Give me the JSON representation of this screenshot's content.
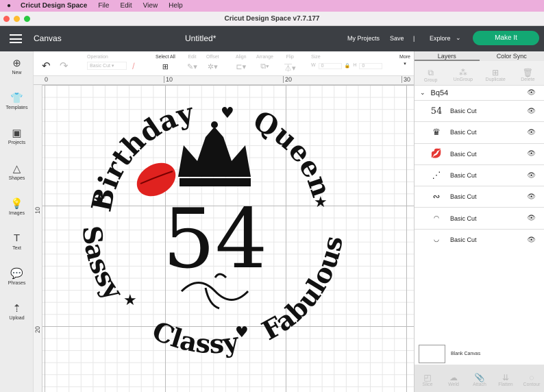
{
  "menubar": {
    "app": "Cricut Design Space",
    "items": [
      "File",
      "Edit",
      "View",
      "Help"
    ]
  },
  "window_title": "Cricut Design Space  v7.7.177",
  "header": {
    "section": "Canvas",
    "doc_title": "Untitled*",
    "my_projects": "My Projects",
    "save": "Save",
    "separator": "|",
    "explore": "Explore",
    "make_it": "Make It"
  },
  "toolbar": {
    "operation_label": "Operation",
    "operation_value": "Basic Cut",
    "select_all": "Select All",
    "edit": "Edit",
    "offset": "Offset",
    "align": "Align",
    "arrange": "Arrange",
    "flip": "Flip",
    "size": "Size",
    "w": "W",
    "h": "H",
    "w_value": "0",
    "h_value": "0",
    "more": "More"
  },
  "sidebar": [
    {
      "label": "New",
      "icon": "⊕"
    },
    {
      "label": "Templates",
      "icon": "👕"
    },
    {
      "label": "Projects",
      "icon": "▣"
    },
    {
      "label": "Shapes",
      "icon": "△"
    },
    {
      "label": "Images",
      "icon": "💡"
    },
    {
      "label": "Text",
      "icon": "T"
    },
    {
      "label": "Phrases",
      "icon": "💬"
    },
    {
      "label": "Upload",
      "icon": "⇡"
    }
  ],
  "ruler": {
    "top": [
      "0",
      "10",
      "20",
      "30"
    ],
    "left": [
      "10",
      "20"
    ]
  },
  "design": {
    "birthday": "Birthday",
    "queen": "Queen",
    "fabulous": "Fabulous",
    "classy": "Classy",
    "sassy": "Sassy",
    "number": "54"
  },
  "panel": {
    "tabs": [
      "Layers",
      "Color Sync"
    ],
    "tools": [
      "Group",
      "UnGroup",
      "Duplicate",
      "Delete"
    ],
    "group_name": "Bq54",
    "layers": [
      {
        "thumb": "54",
        "label": "Basic Cut"
      },
      {
        "thumb": "♛",
        "label": "Basic Cut"
      },
      {
        "thumb": "💋",
        "label": "Basic Cut"
      },
      {
        "thumb": "⋰",
        "label": "Basic Cut"
      },
      {
        "thumb": "∾",
        "label": "Basic Cut"
      },
      {
        "thumb": "◜◝",
        "label": "Basic Cut"
      },
      {
        "thumb": "◟◞",
        "label": "Basic Cut"
      }
    ],
    "blank_canvas": "Blank Canvas",
    "bottom_tools": [
      "Slice",
      "Weld",
      "Attach",
      "Flatten",
      "Contour"
    ]
  },
  "colors": {
    "make_it": "#13a873",
    "header": "#3c3f44",
    "lips": "#e0221f"
  }
}
